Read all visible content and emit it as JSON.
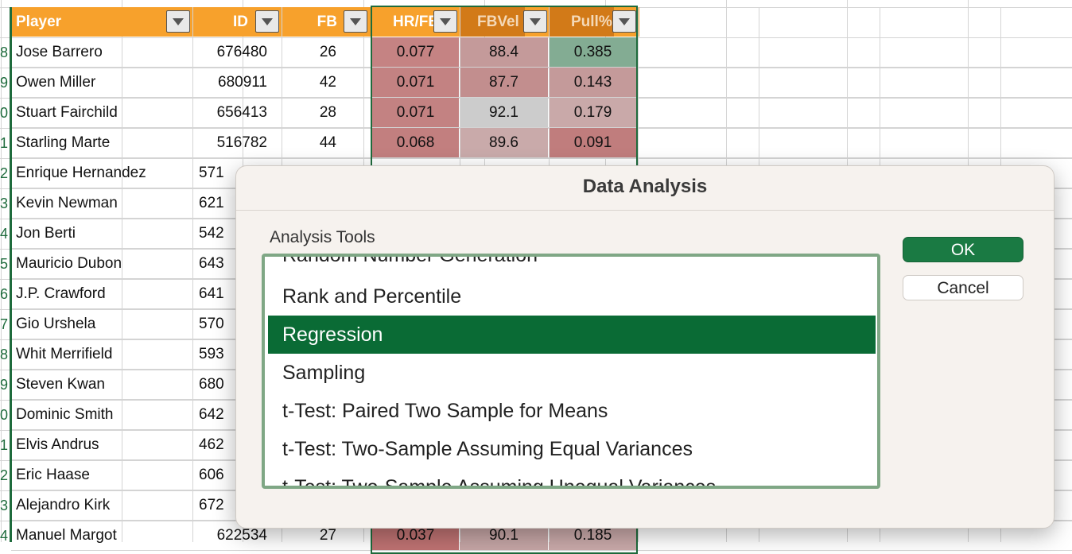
{
  "sheet": {
    "headers": [
      "Player",
      "ID",
      "FB",
      "HR/FB",
      "FBVel",
      "Pull%"
    ],
    "row_numbers": [
      "8",
      "9",
      "0",
      "1",
      "2",
      "3",
      "4",
      "5",
      "6",
      "7",
      "8",
      "9",
      "0",
      "1",
      "2",
      "3",
      "4"
    ],
    "rows": [
      {
        "player": "Jose Barrero",
        "id": "676480",
        "fb": "26",
        "hrfb": "0.077",
        "fbvel": "88.4",
        "pull": "0.385"
      },
      {
        "player": "Owen Miller",
        "id": "680911",
        "fb": "42",
        "hrfb": "0.071",
        "fbvel": "87.7",
        "pull": "0.143"
      },
      {
        "player": "Stuart Fairchild",
        "id": "656413",
        "fb": "28",
        "hrfb": "0.071",
        "fbvel": "92.1",
        "pull": "0.179"
      },
      {
        "player": "Starling Marte",
        "id": "516782",
        "fb": "44",
        "hrfb": "0.068",
        "fbvel": "89.6",
        "pull": "0.091"
      },
      {
        "player": "Enrique Hernandez",
        "id": "571",
        "fb": "",
        "hrfb": "",
        "fbvel": "",
        "pull": ""
      },
      {
        "player": "Kevin Newman",
        "id": "621",
        "fb": "",
        "hrfb": "",
        "fbvel": "",
        "pull": ""
      },
      {
        "player": "Jon Berti",
        "id": "542",
        "fb": "",
        "hrfb": "",
        "fbvel": "",
        "pull": ""
      },
      {
        "player": "Mauricio Dubon",
        "id": "643",
        "fb": "",
        "hrfb": "",
        "fbvel": "",
        "pull": ""
      },
      {
        "player": "J.P. Crawford",
        "id": "641",
        "fb": "",
        "hrfb": "",
        "fbvel": "",
        "pull": ""
      },
      {
        "player": "Gio Urshela",
        "id": "570",
        "fb": "",
        "hrfb": "",
        "fbvel": "",
        "pull": ""
      },
      {
        "player": "Whit Merrifield",
        "id": "593",
        "fb": "",
        "hrfb": "",
        "fbvel": "",
        "pull": ""
      },
      {
        "player": "Steven Kwan",
        "id": "680",
        "fb": "",
        "hrfb": "",
        "fbvel": "",
        "pull": ""
      },
      {
        "player": "Dominic Smith",
        "id": "642",
        "fb": "",
        "hrfb": "",
        "fbvel": "",
        "pull": ""
      },
      {
        "player": "Elvis Andrus",
        "id": "462",
        "fb": "",
        "hrfb": "",
        "fbvel": "",
        "pull": ""
      },
      {
        "player": "Eric Haase",
        "id": "606",
        "fb": "",
        "hrfb": "",
        "fbvel": "",
        "pull": ""
      },
      {
        "player": "Alejandro Kirk",
        "id": "672",
        "fb": "",
        "hrfb": "",
        "fbvel": "",
        "pull": ""
      },
      {
        "player": "Manuel Margot",
        "id": "622534",
        "fb": "27",
        "hrfb": "0.037",
        "fbvel": "90.1",
        "pull": "0.185"
      }
    ]
  },
  "dialog": {
    "title": "Data Analysis",
    "tools_label": "Analysis Tools",
    "items": [
      "Random Number Generation",
      "Rank and Percentile",
      "Regression",
      "Sampling",
      "t-Test: Paired Two Sample for Means",
      "t-Test: Two-Sample Assuming Equal Variances",
      "t-Test: Two-Sample Assuming Unequal Variances"
    ],
    "selected": "Regression",
    "ok_label": "OK",
    "cancel_label": "Cancel"
  },
  "colors": {
    "header_orange": "#f7a12c",
    "selection_green": "#1e6b3c",
    "list_selected": "#0a6b35",
    "ok_button": "#1a7a43"
  }
}
